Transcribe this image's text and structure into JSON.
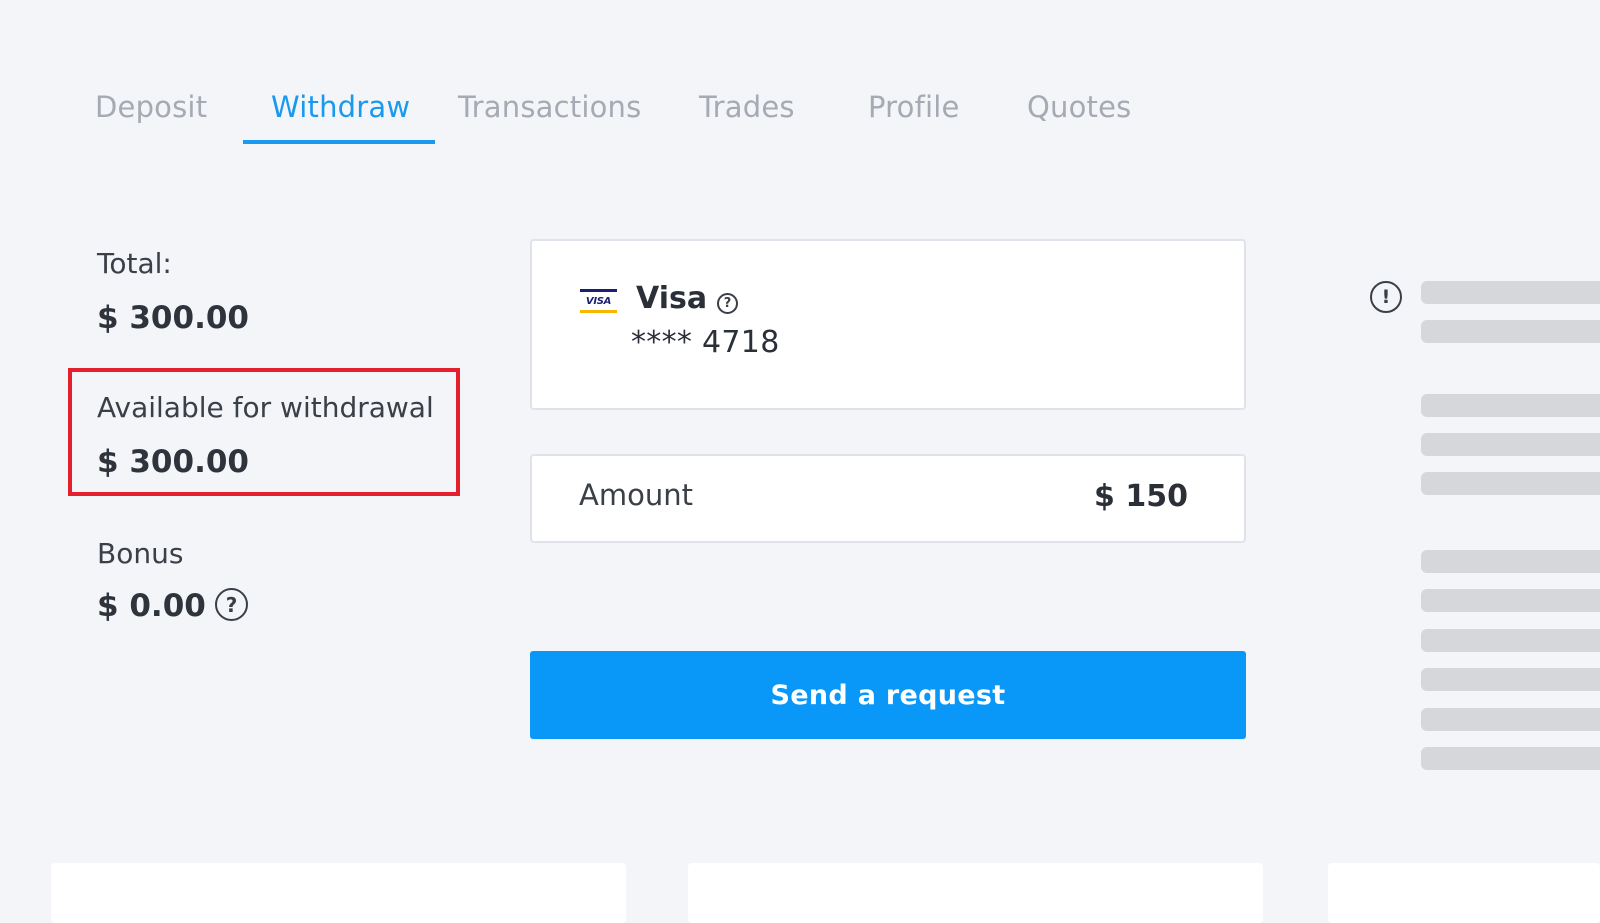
{
  "tabs": [
    {
      "label": "Deposit"
    },
    {
      "label": "Withdraw"
    },
    {
      "label": "Transactions"
    },
    {
      "label": "Trades"
    },
    {
      "label": "Profile"
    },
    {
      "label": "Quotes"
    }
  ],
  "active_tab": "Withdraw",
  "balances": {
    "total_label": "Total:",
    "total_value": "$ 300.00",
    "available_label": "Available for withdrawal",
    "available_value": "$ 300.00",
    "bonus_label": "Bonus",
    "bonus_value": "$ 0.00"
  },
  "card": {
    "logo_text": "VISA",
    "title": "Visa",
    "help_symbol": "?",
    "number": "**** 4718"
  },
  "amount": {
    "label": "Amount",
    "value": "$ 150"
  },
  "send_button_label": "Send a request",
  "info_symbol": "!",
  "colors": {
    "accent": "#0a98f8",
    "active_tab": "#1a99ee",
    "highlight": "#e5202e",
    "background": "#f3f5f9"
  }
}
